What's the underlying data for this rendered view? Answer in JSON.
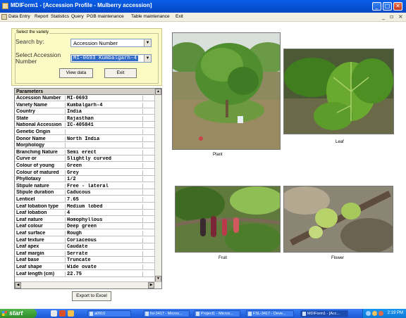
{
  "window": {
    "title": "MDIForm1 - [Accession Profile - Mulberry accession]",
    "minimize_glyph": "_",
    "maximize_glyph": "□",
    "close_glyph": "✕"
  },
  "menu": {
    "items": [
      "Data Entry",
      "Report",
      "Statistics",
      "Query",
      "PGB maintenance",
      "Table maintenance",
      "Exit"
    ],
    "mdi_min": "_",
    "mdi_restore": "▫",
    "mdi_close": "×"
  },
  "select_panel": {
    "legend": "Select the variety",
    "search_by_label": "Search by:",
    "search_by_value": "Accession Number",
    "accession_label": "Select Accession Number",
    "accession_value": "MI-0693  Kumbalgarh-4",
    "view_button": "View data",
    "exit_button": "Exit"
  },
  "grid": {
    "header": "Parameters",
    "rows": [
      [
        "Accession Number",
        "MI-0693"
      ],
      [
        "Variety Name",
        "Kumbalgarh-4"
      ],
      [
        "Country",
        "India"
      ],
      [
        "State",
        "Rajasthan"
      ],
      [
        "National Accession",
        "IC-405841"
      ],
      [
        "Genetic Origin",
        ""
      ],
      [
        "Donor Name",
        "North India"
      ],
      [
        "Morphology",
        ""
      ],
      [
        "Branching Nature",
        "Semi erect"
      ],
      [
        "Curve or",
        "Slightly curved"
      ],
      [
        "Colour of young",
        "Green"
      ],
      [
        "Colour of matured",
        "Grey"
      ],
      [
        "Phyllotaxy",
        "1/2"
      ],
      [
        "Stipule nature",
        "Free - lateral"
      ],
      [
        "Stipule duration",
        "Caducous"
      ],
      [
        "Lenticel",
        "7.65"
      ],
      [
        "Leaf lobation type",
        "Medium lobed"
      ],
      [
        "Leaf lobation",
        "4"
      ],
      [
        "Leaf nature",
        "Homophyllous"
      ],
      [
        "Leaf colour",
        "Deep green"
      ],
      [
        "Leaf surface",
        "Rough"
      ],
      [
        "Leaf texture",
        "Coriaceous"
      ],
      [
        "Leaf apex",
        "Caudate"
      ],
      [
        "Leaf margin",
        "Serrate"
      ],
      [
        "Leaf base",
        "Truncate"
      ],
      [
        "Leaf shape",
        "Wide ovate"
      ],
      [
        "Leaf length (cm)",
        "22.75"
      ]
    ],
    "scroll_up": "▲",
    "scroll_down": "▼",
    "scroll_left": "◀",
    "scroll_right": "▶"
  },
  "export_button": "Export to Excel",
  "photos": {
    "plant": "Plant",
    "leaf": "Leaf",
    "fruit": "Fruit",
    "flower": "Flower"
  },
  "taskbar": {
    "start": "start",
    "items": [
      "a0910",
      "fol-3417 - Micros...",
      "Project1 - Micros...",
      "FSL-3417 - Deve...",
      "MDIForm1 - [Acc..."
    ],
    "clock": "2:19 PM"
  }
}
